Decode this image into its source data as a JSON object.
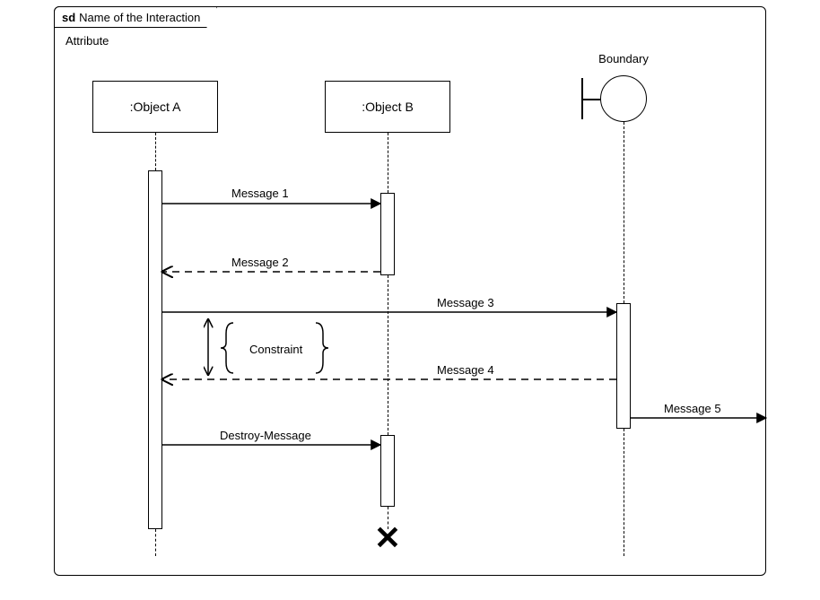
{
  "frame": {
    "prefix": "sd",
    "title": "Name of the Interaction",
    "attribute": "Attribute"
  },
  "lifelines": {
    "objectA": ":Object A",
    "objectB": ":Object B",
    "boundary": "Boundary"
  },
  "messages": {
    "m1": "Message 1",
    "m2": "Message 2",
    "m3": "Message 3",
    "m4": "Message 4",
    "m5": "Message 5",
    "destroy": "Destroy-Message"
  },
  "constraint": {
    "label": "Constraint"
  }
}
